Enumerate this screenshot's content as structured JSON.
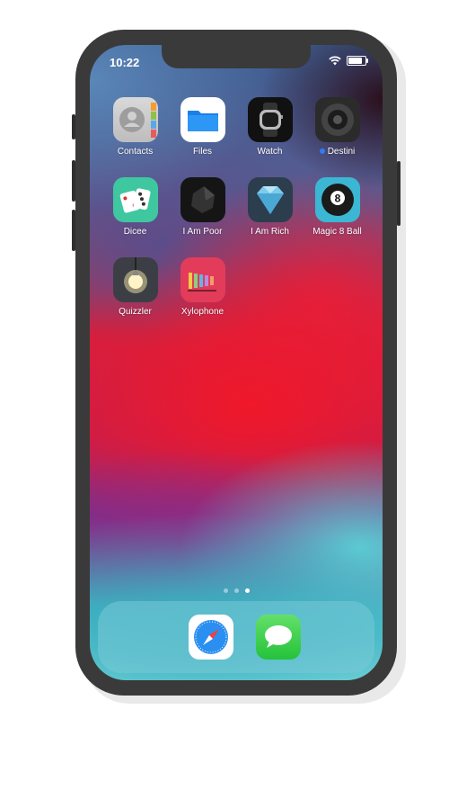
{
  "status_bar": {
    "time": "10:22",
    "wifi_icon": "wifi-icon",
    "battery_icon": "battery-icon"
  },
  "home": {
    "apps": [
      {
        "label": "Contacts",
        "icon": "contacts-icon"
      },
      {
        "label": "Files",
        "icon": "folder-icon"
      },
      {
        "label": "Watch",
        "icon": "watch-icon"
      },
      {
        "label": "Destini",
        "icon": "destini-icon",
        "badge": "new-dot"
      },
      {
        "label": "Dicee",
        "icon": "dice-icon"
      },
      {
        "label": "I Am Poor",
        "icon": "coal-icon"
      },
      {
        "label": "I Am Rich",
        "icon": "diamond-icon"
      },
      {
        "label": "Magic 8 Ball",
        "icon": "eight-ball-icon"
      },
      {
        "label": "Quizzler",
        "icon": "lightbulb-icon"
      },
      {
        "label": "Xylophone",
        "icon": "xylophone-icon"
      }
    ],
    "page_count": 3,
    "active_page": 3
  },
  "dock": {
    "apps": [
      {
        "label": "Safari",
        "icon": "compass-icon"
      },
      {
        "label": "Messages",
        "icon": "speech-bubble-icon"
      }
    ]
  },
  "colors": {
    "dock_tint": "#78c8d7",
    "badge_blue": "#2f7cf6"
  }
}
